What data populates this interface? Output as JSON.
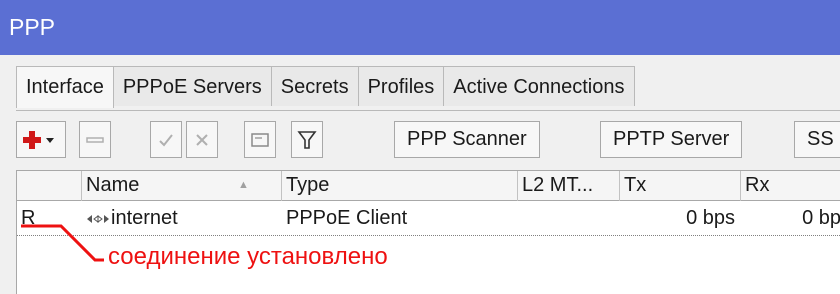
{
  "window": {
    "title": "PPP"
  },
  "tabs": [
    {
      "label": "Interface",
      "active": true
    },
    {
      "label": "PPPoE Servers"
    },
    {
      "label": "Secrets"
    },
    {
      "label": "Profiles"
    },
    {
      "label": "Active Connections"
    }
  ],
  "toolbar": {
    "add_icon": "plus-icon",
    "remove_icon": "minus-icon",
    "enable_icon": "check-icon",
    "disable_icon": "cross-icon",
    "comment_icon": "note-icon",
    "filter_icon": "filter-icon",
    "ppp_scanner_label": "PPP Scanner",
    "pptp_server_label": "PPTP Server",
    "cut_button_label": "SS"
  },
  "table": {
    "columns": {
      "flag": "",
      "name": "Name",
      "type": "Type",
      "l2mtu": "L2 MT...",
      "tx": "Tx",
      "rx": "Rx"
    },
    "sort_indicator": "▲",
    "rows": [
      {
        "flag": "R",
        "icon": "interface-icon",
        "name": "internet",
        "type": "PPPoE Client",
        "l2mtu": "",
        "tx": "0 bps",
        "rx": "0 bp"
      }
    ]
  },
  "annotation": {
    "text": "соединение установлено",
    "color": "#ee1111"
  },
  "colors": {
    "titlebar": "#5b6fd3",
    "add_icon": "#d01818",
    "annotation": "#ee1111"
  }
}
